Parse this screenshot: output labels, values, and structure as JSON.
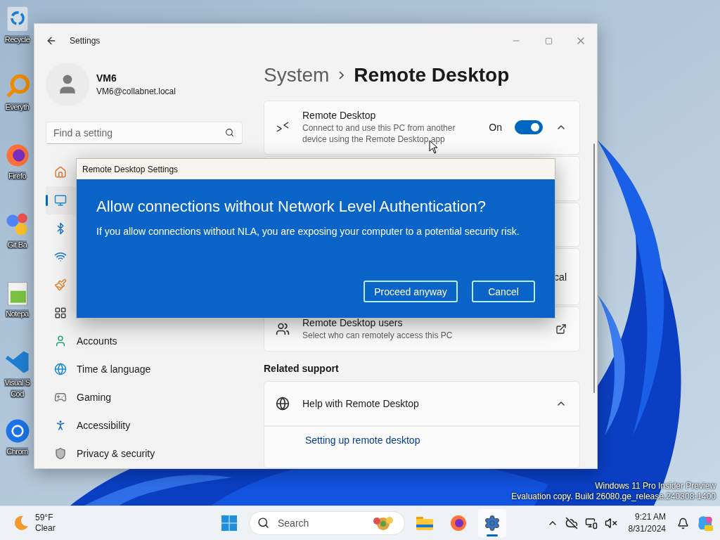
{
  "desktop_icons": [
    {
      "kind": "recycle",
      "lines": [
        "Recycle"
      ]
    },
    {
      "kind": "search",
      "lines": [
        "Everyth"
      ]
    },
    {
      "kind": "browser",
      "lines": [
        "Firefo"
      ]
    },
    {
      "kind": "git",
      "lines": [
        "Git Ba"
      ]
    },
    {
      "kind": "notepad",
      "lines": [
        "Notepa"
      ]
    },
    {
      "kind": "code",
      "lines": [
        "Visual S",
        "Cod"
      ]
    },
    {
      "kind": "chrome",
      "lines": [
        "Chrom"
      ]
    }
  ],
  "settings_window": {
    "title": "Settings",
    "profile": {
      "name": "VM6",
      "email": "VM6@collabnet.local"
    },
    "search": {
      "placeholder": "Find a setting"
    },
    "nav_items": [
      {
        "kind": "home",
        "selected": false
      },
      {
        "kind": "system",
        "selected": true
      },
      {
        "kind": "bluetooth",
        "selected": false
      },
      {
        "kind": "network",
        "selected": false
      },
      {
        "kind": "personalization",
        "selected": false
      },
      {
        "kind": "apps",
        "selected": false
      },
      {
        "kind": "accounts",
        "label": "Accounts",
        "selected": false
      },
      {
        "kind": "time",
        "label": "Time & language",
        "selected": false
      },
      {
        "kind": "gaming",
        "label": "Gaming",
        "selected": false
      },
      {
        "kind": "accessibility",
        "label": "Accessibility",
        "selected": false
      },
      {
        "kind": "privacy",
        "label": "Privacy & security",
        "selected": false
      }
    ],
    "breadcrumb": [
      "System",
      "Remote Desktop"
    ],
    "remote_desktop": {
      "title": "Remote Desktop",
      "description": "Connect to and use this PC from another device using the Remote Desktop app",
      "toggle_label": "On",
      "on": true,
      "expanded": true
    },
    "rows": [
      {
        "kind": "blank"
      },
      {
        "kind": "blank"
      },
      {
        "kind": "value",
        "value": "cal"
      },
      {
        "kind": "users",
        "title": "Remote Desktop users",
        "description": "Select who can remotely access this PC"
      }
    ],
    "related_support": {
      "heading": "Related support",
      "title": "Help with Remote Desktop",
      "expanded": true,
      "links": [
        "Setting up remote desktop"
      ]
    }
  },
  "dialog": {
    "title": "Remote Desktop Settings",
    "heading": "Allow connections without Network Level Authentication?",
    "message": "If you allow connections without NLA, you are exposing your computer to a potential security risk.",
    "buttons": [
      "Proceed anyway",
      "Cancel"
    ]
  },
  "system_notice": [
    "Windows 11 Pro Insider Preview",
    "Evaluation copy. Build 26080.ge_release.240308-1400"
  ],
  "taskbar": {
    "weather": {
      "temperature": "59°F",
      "condition": "Clear"
    },
    "search": {
      "placeholder": "Search"
    },
    "apps": [
      {
        "kind": "explorer",
        "active": false
      },
      {
        "kind": "firefox",
        "active": false
      },
      {
        "kind": "settings",
        "active": true
      }
    ],
    "clock": {
      "time": "9:21 AM",
      "date": "8/31/2024"
    }
  }
}
